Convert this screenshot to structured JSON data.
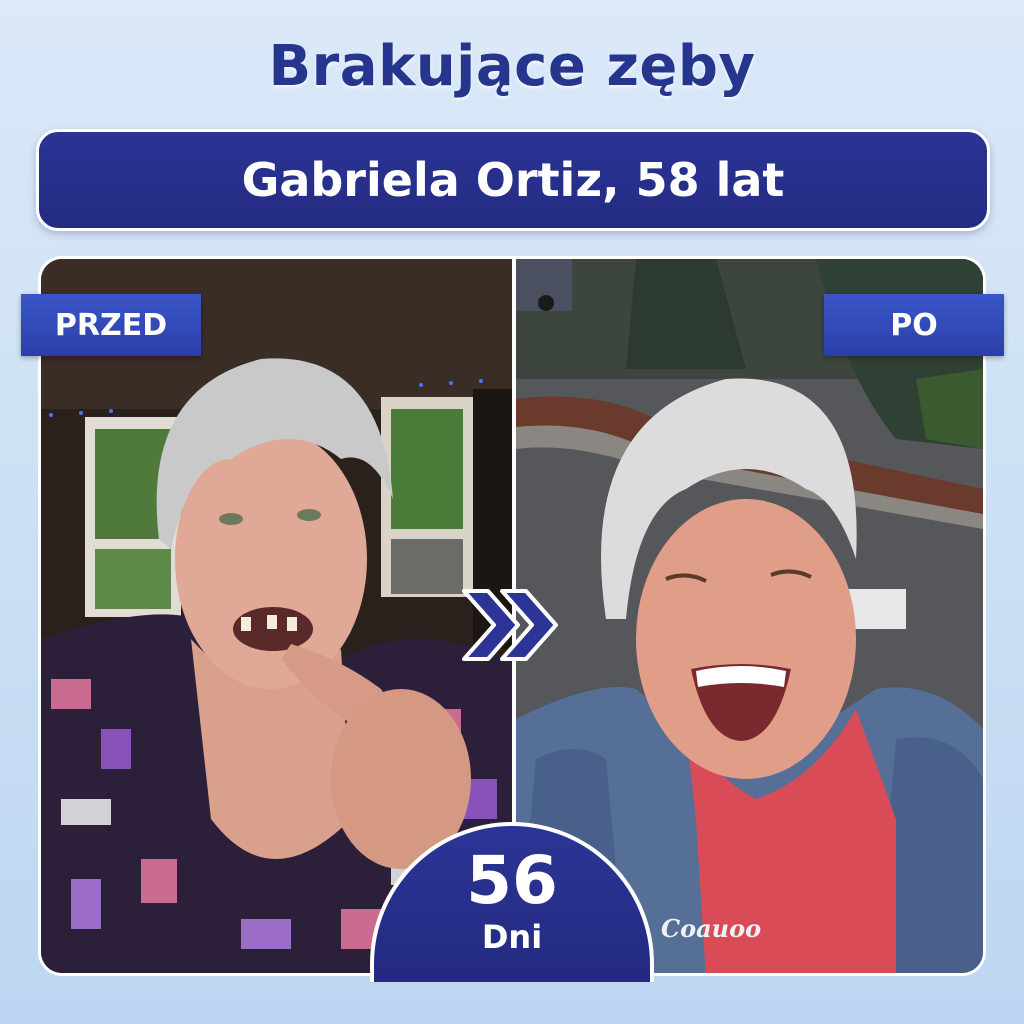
{
  "headline": "Brakujące zęby",
  "person": "Gabriela Ortiz, 58 lat",
  "labels": {
    "before": "PRZED",
    "after": "PO"
  },
  "duration": {
    "value": "56",
    "unit": "Dni"
  },
  "jacket_brand": "Coauoo",
  "colors": {
    "brand_navy": "#26368f",
    "tag_blue": "#2f48b8",
    "background": "#d4e5f6"
  }
}
